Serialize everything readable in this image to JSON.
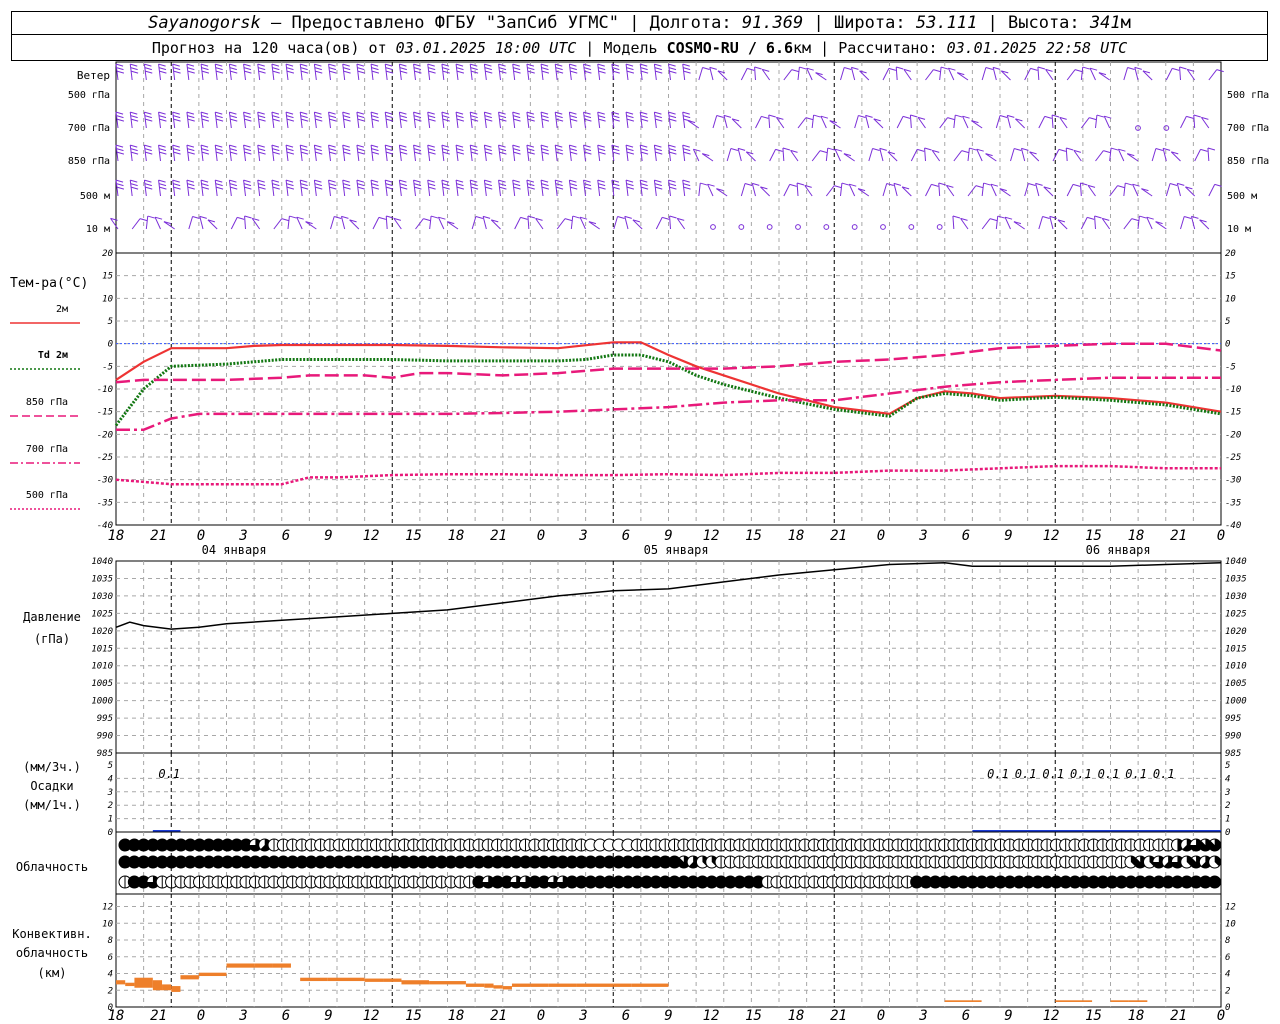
{
  "header": {
    "station": "Sayanogorsk",
    "dash": " – ",
    "provider": "Предоставлено ФГБУ \"ЗапСиб УГМС\"",
    "lon_label": "Долгота:",
    "lon_value": "91.369",
    "lat_label": "Широта:",
    "lat_value": "53.111",
    "alt_label": "Высота:",
    "alt_value": "341",
    "alt_unit": "м",
    "sep": " | "
  },
  "subheader": {
    "forecast_prefix": "Прогноз на 120 часа(ов) от",
    "forecast_time": "03.01.2025 18:00 UTC",
    "model_label": "Модель",
    "model_name": "COSMO-RU / 6.6",
    "model_unit": "км",
    "calc_label": "Рассчитано:",
    "calc_time": "03.01.2025 22:58 UTC",
    "sep": " | "
  },
  "axes": {
    "time_ticks": [
      "18",
      "21",
      "0",
      "3",
      "6",
      "9",
      "12",
      "15",
      "18",
      "21",
      "0",
      "3",
      "6",
      "9",
      "12",
      "15",
      "18",
      "21",
      "0",
      "3",
      "6",
      "9",
      "12",
      "15",
      "18",
      "21",
      "0"
    ],
    "day_labels": [
      "04 января",
      "05 января",
      "06 января"
    ],
    "wind_title": "Ветер",
    "wind_levels": [
      "500 гПа",
      "700 гПа",
      "850 гПа",
      "500 м",
      "10 м"
    ],
    "temp_title": "Тем-ра(°C)",
    "temp_ticks": [
      "20",
      "15",
      "10",
      "5",
      "0",
      "-5",
      "-10",
      "-15",
      "-20",
      "-25",
      "-30",
      "-35",
      "-40"
    ],
    "pres_title_1": "Давление",
    "pres_title_2": "(гПа)",
    "pres_ticks": [
      "1040",
      "1035",
      "1030",
      "1025",
      "1020",
      "1015",
      "1010",
      "1005",
      "1000",
      "995",
      "990",
      "985"
    ],
    "precip_title_1": "(мм/3ч.)",
    "precip_title_2": "Осадки",
    "precip_title_3": "(мм/1ч.)",
    "precip_ticks": [
      "5",
      "4",
      "3",
      "2",
      "1",
      "0"
    ],
    "cloud_title": "Облачность",
    "conv_title_1": "Конвективн.",
    "conv_title_2": "облачность",
    "conv_title_3": "(км)",
    "conv_ticks": [
      "12",
      "10",
      "8",
      "6",
      "4",
      "2",
      "0"
    ]
  },
  "legend": [
    {
      "label": "2м",
      "italic_prefix": "",
      "color": "#ee3333",
      "style": "solid"
    },
    {
      "label": "2м",
      "italic_prefix": "Td",
      "color": "#117711",
      "style": "dotted"
    },
    {
      "label": "850 гПа",
      "italic_prefix": "",
      "color": "#e8197a",
      "style": "dashed"
    },
    {
      "label": "700 гПа",
      "italic_prefix": "",
      "color": "#e8197a",
      "style": "dashdot"
    },
    {
      "label": "500 гПа",
      "italic_prefix": "",
      "color": "#e8197a",
      "style": "dotted"
    }
  ],
  "colors": {
    "wind": "#7b2fd8",
    "t2m": "#ee3333",
    "td2m": "#117711",
    "t_upper": "#e8197a",
    "pressure": "#000000",
    "precip": "#1a3ad6",
    "conv": "#ee7f2a",
    "grid": "#a8a8a8",
    "zero_line": "#3355ff"
  },
  "chart_data": [
    {
      "type": "line",
      "title": "Тем-ра(°C)",
      "x_unit": "hours since 03.01.2025 18:00 UTC",
      "ylim": [
        -40,
        20
      ],
      "series": [
        {
          "name": "2м",
          "points": [
            [
              0,
              -8
            ],
            [
              3,
              -4
            ],
            [
              6,
              -1
            ],
            [
              9,
              -1
            ],
            [
              12,
              -1
            ],
            [
              15,
              -0.5
            ],
            [
              18,
              -0.3
            ],
            [
              24,
              -0.3
            ],
            [
              30,
              -0.3
            ],
            [
              36,
              -0.5
            ],
            [
              42,
              -0.8
            ],
            [
              48,
              -1
            ],
            [
              54,
              0.3
            ],
            [
              57,
              0.3
            ],
            [
              60,
              -2.5
            ],
            [
              63,
              -5
            ],
            [
              66,
              -7
            ],
            [
              72,
              -11
            ],
            [
              78,
              -14
            ],
            [
              84,
              -15.5
            ],
            [
              87,
              -12
            ],
            [
              90,
              -10.5
            ],
            [
              93,
              -11
            ],
            [
              96,
              -12
            ],
            [
              102,
              -11.5
            ],
            [
              108,
              -12
            ],
            [
              114,
              -13
            ],
            [
              120,
              -15
            ]
          ]
        },
        {
          "name": "Td 2м",
          "points": [
            [
              0,
              -18
            ],
            [
              3,
              -10
            ],
            [
              6,
              -5
            ],
            [
              12,
              -4.5
            ],
            [
              18,
              -3.5
            ],
            [
              24,
              -3.5
            ],
            [
              30,
              -3.5
            ],
            [
              36,
              -3.8
            ],
            [
              42,
              -3.8
            ],
            [
              48,
              -3.8
            ],
            [
              51,
              -3.5
            ],
            [
              54,
              -2.5
            ],
            [
              57,
              -2.5
            ],
            [
              60,
              -4
            ],
            [
              63,
              -7
            ],
            [
              66,
              -9
            ],
            [
              72,
              -12
            ],
            [
              78,
              -14.5
            ],
            [
              84,
              -16
            ],
            [
              87,
              -12
            ],
            [
              90,
              -11
            ],
            [
              93,
              -11.5
            ],
            [
              96,
              -12.5
            ],
            [
              102,
              -11.8
            ],
            [
              108,
              -12.5
            ],
            [
              114,
              -13.5
            ],
            [
              120,
              -15.5
            ]
          ]
        },
        {
          "name": "850 гПа",
          "points": [
            [
              0,
              -8.5
            ],
            [
              3,
              -8
            ],
            [
              6,
              -8
            ],
            [
              12,
              -8
            ],
            [
              18,
              -7.5
            ],
            [
              21,
              -7
            ],
            [
              24,
              -7
            ],
            [
              27,
              -7
            ],
            [
              30,
              -7.5
            ],
            [
              33,
              -6.5
            ],
            [
              36,
              -6.5
            ],
            [
              42,
              -7
            ],
            [
              48,
              -6.5
            ],
            [
              54,
              -5.5
            ],
            [
              60,
              -5.5
            ],
            [
              66,
              -5.5
            ],
            [
              72,
              -5
            ],
            [
              78,
              -4
            ],
            [
              84,
              -3.5
            ],
            [
              90,
              -2.5
            ],
            [
              96,
              -1
            ],
            [
              102,
              -0.5
            ],
            [
              108,
              0
            ],
            [
              114,
              0
            ],
            [
              120,
              -1.5
            ]
          ]
        },
        {
          "name": "700 гПа",
          "points": [
            [
              0,
              -19
            ],
            [
              3,
              -19
            ],
            [
              6,
              -16.5
            ],
            [
              9,
              -15.5
            ],
            [
              12,
              -15.5
            ],
            [
              18,
              -15.5
            ],
            [
              24,
              -15.5
            ],
            [
              30,
              -15.5
            ],
            [
              36,
              -15.5
            ],
            [
              42,
              -15.3
            ],
            [
              48,
              -15
            ],
            [
              54,
              -14.5
            ],
            [
              60,
              -14
            ],
            [
              66,
              -13
            ],
            [
              72,
              -12.5
            ],
            [
              78,
              -12.5
            ],
            [
              84,
              -11
            ],
            [
              90,
              -9.5
            ],
            [
              96,
              -8.5
            ],
            [
              102,
              -8
            ],
            [
              108,
              -7.5
            ],
            [
              114,
              -7.5
            ],
            [
              120,
              -7.5
            ]
          ]
        },
        {
          "name": "500 гПа",
          "points": [
            [
              0,
              -30
            ],
            [
              3,
              -30.5
            ],
            [
              6,
              -31
            ],
            [
              12,
              -31
            ],
            [
              18,
              -31
            ],
            [
              21,
              -29.5
            ],
            [
              24,
              -29.5
            ],
            [
              30,
              -29
            ],
            [
              36,
              -28.8
            ],
            [
              42,
              -28.8
            ],
            [
              48,
              -29
            ],
            [
              54,
              -29
            ],
            [
              60,
              -28.8
            ],
            [
              66,
              -29
            ],
            [
              72,
              -28.5
            ],
            [
              78,
              -28.5
            ],
            [
              84,
              -28
            ],
            [
              90,
              -28
            ],
            [
              96,
              -27.5
            ],
            [
              102,
              -27
            ],
            [
              108,
              -27
            ],
            [
              114,
              -27.5
            ],
            [
              120,
              -27.5
            ]
          ]
        }
      ]
    },
    {
      "type": "line",
      "title": "Давление (гПа)",
      "x_unit": "hours since 03.01.2025 18:00 UTC",
      "ylim": [
        985,
        1040
      ],
      "series": [
        {
          "name": "",
          "points": [
            [
              0,
              1021
            ],
            [
              1.5,
              1022.5
            ],
            [
              3,
              1021.5
            ],
            [
              6,
              1020.5
            ],
            [
              9,
              1021
            ],
            [
              12,
              1022
            ],
            [
              18,
              1023
            ],
            [
              24,
              1024
            ],
            [
              30,
              1025
            ],
            [
              36,
              1026
            ],
            [
              42,
              1028
            ],
            [
              48,
              1030
            ],
            [
              54,
              1031.5
            ],
            [
              60,
              1032
            ],
            [
              66,
              1034
            ],
            [
              72,
              1036
            ],
            [
              78,
              1037.5
            ],
            [
              84,
              1039
            ],
            [
              90,
              1039.5
            ],
            [
              93,
              1038.5
            ],
            [
              96,
              1038.5
            ],
            [
              102,
              1038.5
            ],
            [
              108,
              1038.5
            ],
            [
              114,
              1039
            ],
            [
              120,
              1039.5
            ]
          ]
        }
      ]
    },
    {
      "type": "bar",
      "title": "Осадки",
      "x_unit": "hours since 03.01.2025 18:00 UTC",
      "ylim": [
        0,
        5
      ],
      "labels": [
        {
          "x": 6,
          "text": "0.1"
        },
        {
          "x": 96,
          "text": "0.1"
        },
        {
          "x": 99,
          "text": "0.1"
        },
        {
          "x": 102,
          "text": "0.1"
        },
        {
          "x": 105,
          "text": "0.1"
        },
        {
          "x": 108,
          "text": "0.1"
        },
        {
          "x": 111,
          "text": "0.1"
        },
        {
          "x": 114,
          "text": "0.1"
        }
      ],
      "bars": [
        [
          4,
          7,
          0.1
        ],
        [
          93,
          96,
          0.05
        ],
        [
          96,
          120,
          0.05
        ]
      ]
    },
    {
      "type": "bar",
      "title": "Конвективн. облачность (км)",
      "x_unit": "hours since 03.01.2025 18:00 UTC",
      "ylim": [
        0,
        13
      ],
      "segments": [
        [
          0,
          1,
          2.7,
          3.2
        ],
        [
          1,
          2,
          2.5,
          2.9
        ],
        [
          2,
          4,
          2.3,
          3.5
        ],
        [
          4,
          5,
          2.0,
          3.2
        ],
        [
          5,
          6,
          2.0,
          2.7
        ],
        [
          6,
          7,
          1.8,
          2.5
        ],
        [
          7,
          9,
          3.3,
          3.8
        ],
        [
          9,
          12,
          3.7,
          4.1
        ],
        [
          12,
          15,
          4.7,
          5.2
        ],
        [
          15,
          17,
          4.7,
          5.2
        ],
        [
          17,
          19,
          4.7,
          5.2
        ],
        [
          20,
          23,
          3.1,
          3.5
        ],
        [
          23,
          27,
          3.1,
          3.5
        ],
        [
          27,
          29,
          3.0,
          3.4
        ],
        [
          29,
          31,
          3.0,
          3.4
        ],
        [
          31,
          34,
          2.7,
          3.2
        ],
        [
          34,
          36,
          2.7,
          3.1
        ],
        [
          36,
          38,
          2.7,
          3.1
        ],
        [
          38,
          40,
          2.4,
          2.8
        ],
        [
          40,
          41,
          2.3,
          2.8
        ],
        [
          41,
          42,
          2.2,
          2.6
        ],
        [
          42,
          43,
          2.1,
          2.5
        ],
        [
          43,
          45,
          2.4,
          2.8
        ],
        [
          45,
          47,
          2.4,
          2.8
        ],
        [
          47,
          50,
          2.4,
          2.8
        ],
        [
          50,
          54,
          2.4,
          2.8
        ],
        [
          54,
          56,
          2.4,
          2.8
        ],
        [
          56,
          60,
          2.4,
          2.8
        ],
        [
          90,
          94,
          0.6,
          0.8
        ],
        [
          102,
          106,
          0.6,
          0.8
        ],
        [
          108,
          110,
          0.6,
          0.8
        ],
        [
          110,
          112,
          0.6,
          0.8
        ]
      ]
    },
    {
      "type": "table",
      "title": "Облачность",
      "rows": [
        "8888888888888865111111111111111111111111111111111100000111111111111111111111111111111111111111111111111111111111145677",
        "8888888888888888888888888888888888888888888888888888888888887533111111111111111111111111111111111111111111113736563753",
        "1886111111111111111111111111111111111186886688668888888888888888888881111111111111111888888888888888888888888888888888"
      ]
    }
  ]
}
